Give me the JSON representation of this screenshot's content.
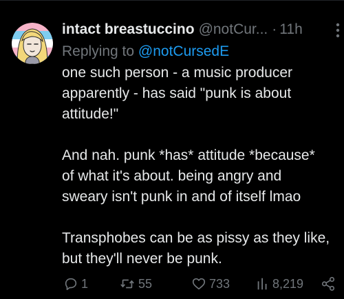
{
  "author": {
    "display_name": "intact breastuccino",
    "handle": "@notCur...",
    "time_separator": "·",
    "time": "11h"
  },
  "reply_context": {
    "prefix": "Replying to",
    "handle": "@notCursedE"
  },
  "body": {
    "paragraphs": [
      [
        "one such person - a music producer",
        "apparently - has said \"punk is about",
        "attitude!\""
      ],
      [
        "And nah. punk *has* attitude *because*",
        "of what it's about. being angry and",
        "sweary isn't punk in and of itself lmao"
      ],
      [
        "Transphobes can be as pissy as they like,",
        "but they'll never be punk."
      ]
    ]
  },
  "actions": {
    "replies": "1",
    "reposts": "55",
    "likes": "733",
    "views": "8,219"
  },
  "icons": {
    "reply": "reply-icon",
    "repost": "repost-icon",
    "like": "heart-icon",
    "views": "views-icon",
    "share": "share-icon",
    "more": "more-icon"
  },
  "colors": {
    "background": "#000000",
    "text": "#e7e9ea",
    "muted": "#71767b",
    "link": "#1d9bf0"
  }
}
